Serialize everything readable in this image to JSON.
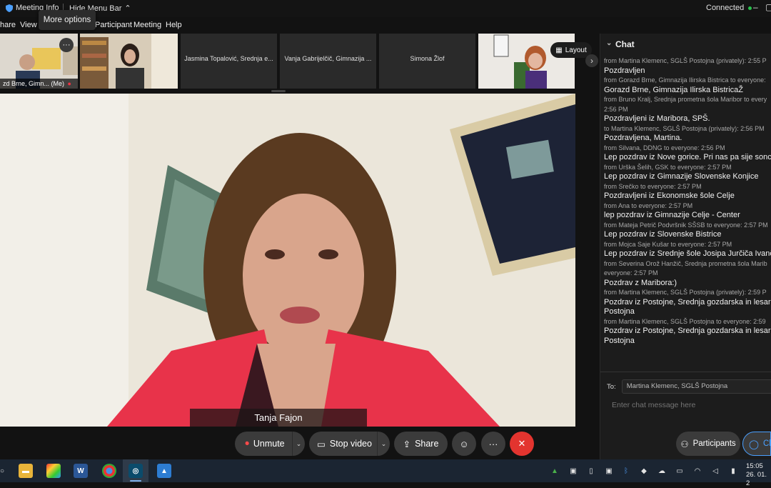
{
  "titlebar": {
    "meeting_info": "Meeting Info",
    "hide_menu_bar": "Hide Menu Bar",
    "connected": "Connected",
    "status_color": "#27c24c"
  },
  "menubar": {
    "items": [
      "hare",
      "View",
      "Participant",
      "Meeting",
      "Help"
    ]
  },
  "tooltip": "More options",
  "thumbnails": {
    "self_label": "zd Brne, Gimn... (Me)",
    "t3_name": "Jasmina Topalović, Srednja e...",
    "t4_name": "Vanja Gabrijelčič, Gimnazija ...",
    "t5_name": "Simona Žlof"
  },
  "layout_button": "Layout",
  "speaker_name": "Tanja Fajon",
  "chat": {
    "title": "Chat",
    "messages": [
      {
        "meta": "from Martina Klemenc, SGLŠ Postojna (privately):   2:55 P",
        "text": "Pozdravljen"
      },
      {
        "meta": "from Gorazd Brne, Gimnazija Ilirska Bistrica to everyone: ",
        "text": "Gorazd Brne, Gimnazija Ilirska BistricaŽ"
      },
      {
        "meta": "from Bruno Kralj, Srednja prometna šola Maribor to every",
        "meta2": "2:56 PM",
        "text": "Pozdravljeni iz Maribora, SPŠ."
      },
      {
        "meta": "to Martina Klemenc, SGLŠ Postojna (privately):   2:56 PM",
        "text": "Pozdravljena, Martina."
      },
      {
        "meta": "from Silvana, DDNG to everyone:    2:56 PM",
        "text": "Lep pozdrav iz Nove gorice. Pri nas pa sije sonce."
      },
      {
        "meta": "from Urška Šelih, GSK to everyone:    2:57 PM",
        "text": "Lep pozdrav iz Gimnazije Slovenske Konjice"
      },
      {
        "meta": "from Srečko to everyone:    2:57 PM",
        "text": "Pozdravljeni iz Ekonomske šole Celje"
      },
      {
        "meta": "from Ana to everyone:    2:57 PM",
        "text": "lep pozdrav iz Gimnazije Celje - Center"
      },
      {
        "meta": "from Mateja Petrič Podvršnik SŠSB to everyone:    2:57 PM",
        "text": "Lep pozdrav iz Slovenske Bistrice"
      },
      {
        "meta": "from Mojca Saje Kušar to everyone:    2:57 PM",
        "text": "Lep pozdrav iz Srednje šole Josipa Jurčiča Ivančna"
      },
      {
        "meta": "from Severina Orož Hanžič, Srednja prometna šola Marib",
        "meta2": "everyone:    2:57 PM",
        "text": "Pozdrav z Maribora:)"
      },
      {
        "meta": "from Martina Klemenc, SGLŠ Postojna (privately):   2:59 P",
        "text": "Pozdrav iz Postojne, Srednja gozdarska in lesarska",
        "text2": "Postojna"
      },
      {
        "meta": "from Martina Klemenc, SGLŠ Postojna to everyone:   2:59",
        "text": "Pozdrav iz Postojne, Srednja gozdarska in lesarska",
        "text2": "Postojna"
      }
    ],
    "to_label": "To:",
    "to_value": "Martina Klemenc, SGLŠ Postojna",
    "input_placeholder": "Enter chat message here"
  },
  "controls": {
    "unmute": "Unmute",
    "stop_video": "Stop video",
    "share": "Share",
    "participants": "Participants",
    "chat": "Ch",
    "end_color": "#e3342f"
  },
  "taskbar": {
    "time": "15:05",
    "date": "26. 01. 2"
  }
}
